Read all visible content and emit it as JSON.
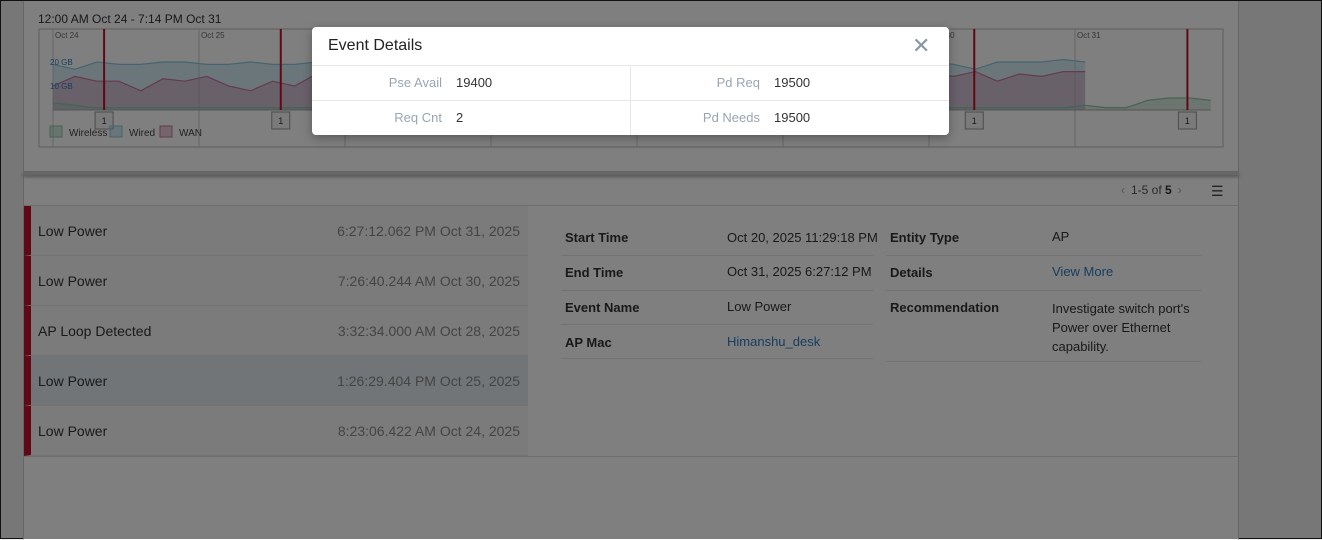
{
  "chart": {
    "range_label": "12:00 AM Oct 24 - 7:14 PM Oct 31",
    "day_labels": [
      {
        "day": 0,
        "label": "Oct 24"
      },
      {
        "day": 1,
        "label": "Oct 25"
      },
      {
        "day": 6,
        "label": "Oct 30"
      },
      {
        "day": 7,
        "label": "Oct 31"
      }
    ],
    "y_labels": [
      {
        "value": 20,
        "label": "20 GB"
      },
      {
        "value": 10,
        "label": "10 GB"
      }
    ],
    "legend": [
      {
        "name": "Wireless",
        "color": "#8fc7a8"
      },
      {
        "name": "Wired",
        "color": "#8ccbe0"
      },
      {
        "name": "WAN",
        "color": "#c9769a"
      }
    ],
    "wired": [
      19,
      17,
      20,
      19,
      19,
      20,
      20,
      19,
      19,
      20,
      19,
      19,
      20,
      19,
      13,
      13,
      12,
      16,
      20,
      14,
      19,
      20,
      20,
      21,
      20,
      20,
      18,
      19,
      19,
      20,
      18,
      19,
      20,
      18,
      21,
      20,
      19,
      19,
      16,
      20,
      20,
      19,
      17,
      20,
      20,
      20,
      21,
      20
    ],
    "wan": [
      10,
      14,
      12,
      12,
      8,
      13,
      12,
      14,
      10,
      8,
      12,
      10,
      15,
      14,
      15,
      12,
      16,
      9,
      7,
      11,
      15,
      14,
      16,
      16,
      14,
      12,
      15,
      13,
      15,
      12,
      10,
      13,
      8,
      12,
      14,
      10,
      12,
      11,
      13,
      10,
      15,
      14,
      16,
      12,
      15,
      14,
      16,
      16
    ],
    "wireless": [
      3,
      2,
      1,
      1,
      1,
      1,
      1,
      1,
      1,
      1,
      1,
      1,
      1,
      1,
      1,
      1,
      1,
      1,
      1,
      1,
      1,
      1,
      1,
      1,
      1,
      1,
      2,
      1,
      1,
      1,
      1,
      1,
      1,
      1,
      1,
      2,
      3,
      2,
      1,
      1,
      1,
      1,
      1,
      1,
      1,
      1,
      1,
      1,
      1,
      2,
      1,
      1,
      4,
      5,
      5,
      4
    ],
    "wired_end_day": 7.07,
    "wireless_end_day": 7.93,
    "events": [
      {
        "day": 0.35,
        "count": "1"
      },
      {
        "day": 1.56,
        "count": "1"
      },
      {
        "day": 6.31,
        "count": "1"
      },
      {
        "day": 7.77,
        "count": "1"
      }
    ],
    "event_color": "#c0102a"
  },
  "pager": {
    "text": "1-5 of ",
    "total": "5"
  },
  "events": [
    {
      "name": "Low Power",
      "time": "6:27:12.062 PM Oct 31, 2025"
    },
    {
      "name": "Low Power",
      "time": "7:26:40.244 AM Oct 30, 2025"
    },
    {
      "name": "AP Loop Detected",
      "time": "3:32:34.000 AM Oct 28, 2025"
    },
    {
      "name": "Low Power",
      "time": "1:26:29.404 PM Oct 25, 2025"
    },
    {
      "name": "Low Power",
      "time": "8:23:06.422 AM Oct 24, 2025"
    }
  ],
  "details": {
    "start_time_label": "Start Time",
    "start_time": "Oct 20, 2025 11:29:18 PM",
    "end_time_label": "End Time",
    "end_time": "Oct 31, 2025 6:27:12 PM",
    "event_name_label": "Event Name",
    "event_name": "Low Power",
    "ap_mac_label": "AP Mac",
    "ap_mac": "Himanshu_desk",
    "entity_type_label": "Entity Type",
    "entity_type": "AP",
    "details_label": "Details",
    "details_link": "View More",
    "recommendation_label": "Recommendation",
    "recommendation": "Investigate switch port's Power over Ethernet capability."
  },
  "modal": {
    "title": "Event Details",
    "pse_avail_label": "Pse Avail",
    "pse_avail": "19400",
    "pd_req_label": "Pd Req",
    "pd_req": "19500",
    "req_cnt_label": "Req Cnt",
    "req_cnt": "2",
    "pd_needs_label": "Pd Needs",
    "pd_needs": "19500"
  }
}
